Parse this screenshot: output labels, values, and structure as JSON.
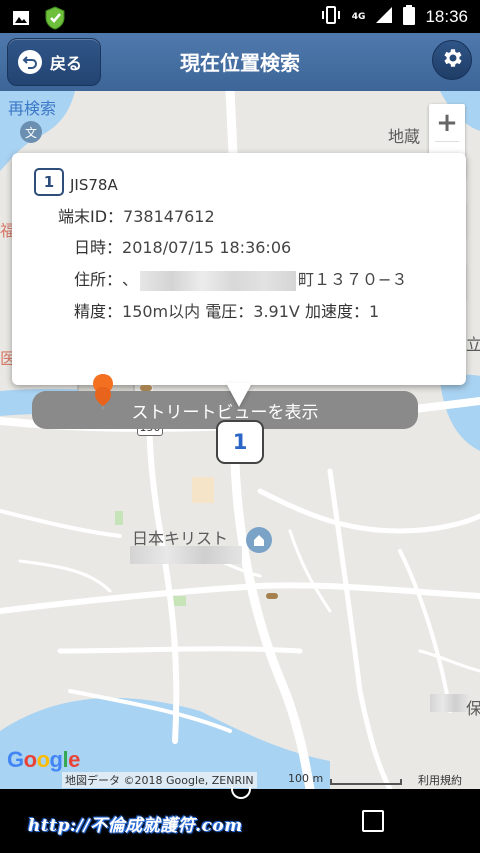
{
  "status_bar": {
    "time": "18:36",
    "network": "4G",
    "icons": [
      "image-icon",
      "shield-icon",
      "vibrate-icon",
      "signal-icon",
      "battery-icon"
    ]
  },
  "app_bar": {
    "back_label": "戻る",
    "title": "現在位置検索",
    "settings_icon": "gear-icon"
  },
  "map": {
    "labels": {
      "research": "再検索",
      "jizo": "地蔵",
      "kyo": "福",
      "shin": "医院",
      "ritsu": "立",
      "church": "日本キリスト",
      "yasu": "保",
      "road_number": "150"
    },
    "controls": {
      "zoom_in": "+",
      "zoom_out": "−"
    },
    "footer": {
      "logo": "Google",
      "attribution": "地図データ ©2018 Google, ZENRIN",
      "scale": "100 m",
      "terms": "利用規約"
    },
    "colors": {
      "land": "#e9e8e4",
      "water": "#a9d3f2",
      "road": "#ffffff",
      "accent": "#3d6597"
    }
  },
  "info_window": {
    "unit_number": "1",
    "unit_name": "JIS78A",
    "terminal_id_label": "端末ID：",
    "terminal_id": "738147612",
    "datetime_label": "日時：",
    "datetime": "2018/07/15 18:36:06",
    "address_label": "住所：",
    "address_prefix": "、",
    "address_suffix": "町１３７０−３",
    "precision_label": "精度：",
    "precision": "150m以内",
    "voltage_label": "電圧：",
    "voltage": "3.91V",
    "accel_label": "加速度：",
    "accel": "1",
    "street_view_button": "ストリートビューを表示"
  },
  "marker": {
    "label": "1"
  },
  "nav_bar": {
    "watermark": "http://不倫成就護符.com"
  }
}
